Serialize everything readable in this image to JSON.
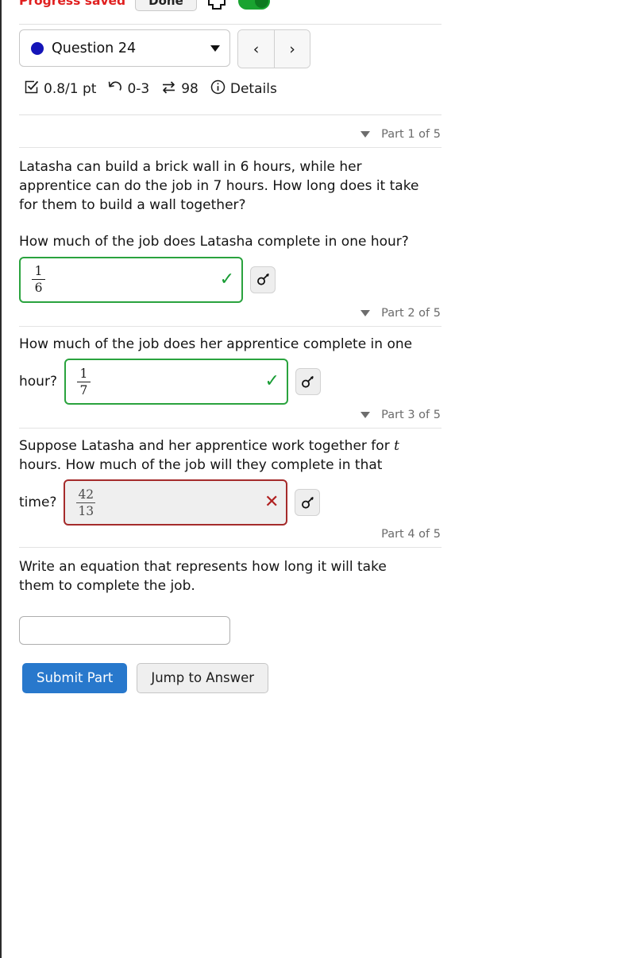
{
  "topbar": {
    "progress_status": "Progress saved",
    "done_label": "Done",
    "print_icon": "printer-icon",
    "toggle_label": "",
    "toggle_state": "on",
    "toggle_color": "#19a330",
    "status_color": "#e02020"
  },
  "selector": {
    "dot_color": "#1414b8",
    "question_label": "Question 24",
    "caret_icon": "chevron-down-icon",
    "prev_label": "‹",
    "next_label": "›"
  },
  "stats": {
    "points_icon": "checkbox-checked-icon",
    "points": "0.8/1 pt",
    "attempts_icon": "undo-arrow-icon",
    "attempts": "0-3",
    "swap_icon": "swap-arrows-icon",
    "swap_count": "98",
    "info_icon": "info-circle-icon",
    "details_label": "Details"
  },
  "parts": [
    {
      "label": "Part 1 of 5",
      "has_caret": true,
      "prompt_lines": [
        "Latasha can build a brick wall in 6 hours, while her",
        "apprentice can do the job in 7 hours. How long does it take",
        "for them to build a wall together?"
      ],
      "sub_prompt": "How much of the job does Latasha complete in one hour?",
      "inline_label": "",
      "answer": {
        "numerator": "1",
        "denominator": "6"
      },
      "state": "correct",
      "mark": "✓",
      "key_icon": "key-icon"
    },
    {
      "label": "Part 2 of 5",
      "has_caret": true,
      "sub_prompt": "How much of the job does her apprentice complete in one",
      "inline_label": "hour?",
      "answer": {
        "numerator": "1",
        "denominator": "7"
      },
      "state": "correct",
      "mark": "✓",
      "key_icon": "key-icon"
    },
    {
      "label": "Part 3 of 5",
      "has_caret": true,
      "prompt_lines": [
        "Suppose Latasha and her apprentice work together for t",
        "hours. How much of the job will they complete in that"
      ],
      "inline_label": "time?",
      "variable": "t",
      "answer": {
        "numerator": "42",
        "denominator": "13"
      },
      "state": "incorrect",
      "mark": "✕",
      "key_icon": "key-icon"
    },
    {
      "label": "Part 4 of 5",
      "has_caret": false,
      "prompt_lines": [
        "Write an equation that represents how long it will take",
        "them to complete the job."
      ],
      "answer_value": "",
      "answer_placeholder": "",
      "state": "empty"
    }
  ],
  "actions": {
    "submit_label": "Submit Part",
    "jump_label": "Jump to Answer",
    "submit_color": "#2878cc"
  }
}
